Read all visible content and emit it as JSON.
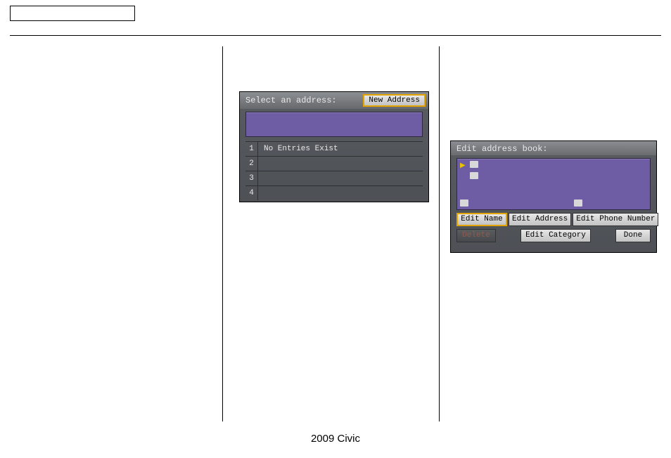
{
  "footer": "2009  Civic",
  "screen1": {
    "title": "Select an address:",
    "new_address": "New Address",
    "rows": [
      {
        "n": "1",
        "v": "No Entries Exist"
      },
      {
        "n": "2",
        "v": ""
      },
      {
        "n": "3",
        "v": ""
      },
      {
        "n": "4",
        "v": ""
      }
    ]
  },
  "screen2": {
    "title": "Edit address book:",
    "edit_name": "Edit Name",
    "edit_address": "Edit Address",
    "edit_phone": "Edit Phone Number",
    "delete": "Delete",
    "edit_category": "Edit Category",
    "done": "Done"
  }
}
